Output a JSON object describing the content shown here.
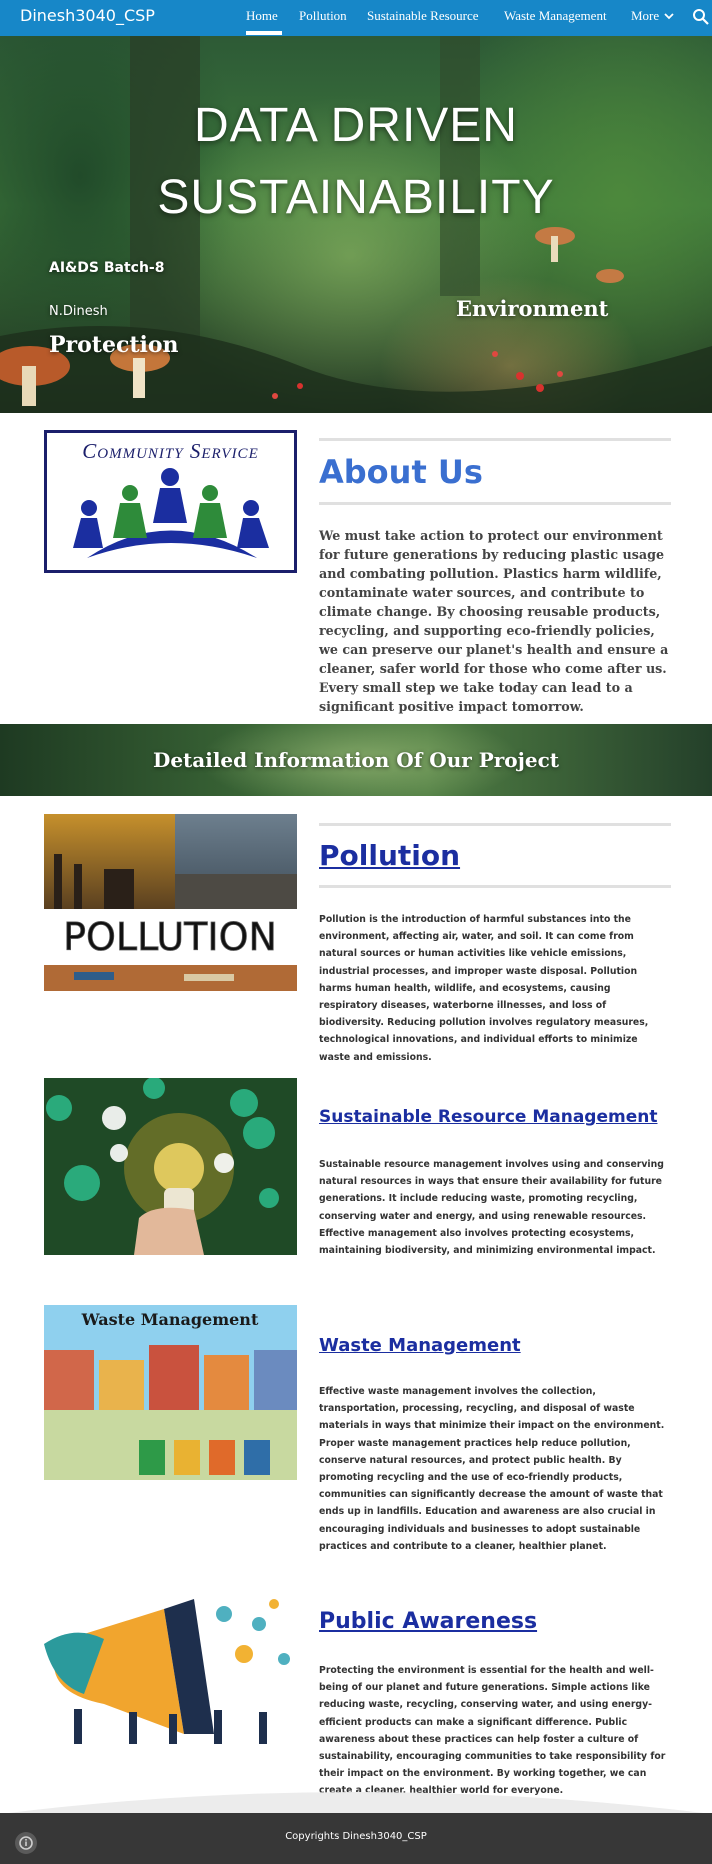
{
  "site": {
    "title": "Dinesh3040_CSP"
  },
  "nav": {
    "items": [
      {
        "label": "Home"
      },
      {
        "label": "Pollution"
      },
      {
        "label": "Sustainable Resource"
      },
      {
        "label": "Waste Management"
      },
      {
        "label": "More"
      }
    ]
  },
  "hero": {
    "title_line1": "DATA DRIVEN",
    "title_line2": "SUSTAINABILITY",
    "batch": "AI&DS Batch-8",
    "author": "N.Dinesh",
    "protection": "Protection",
    "environment": "Environment"
  },
  "about": {
    "logo_text": "Community Service",
    "heading": "About Us",
    "body": "We must take action to protect our environment for future generations by reducing plastic usage and combating pollution. Plastics harm wildlife, contaminate water sources, and contribute to climate change. By choosing reusable products, recycling, and supporting eco-friendly policies, we can preserve our planet's health and ensure a cleaner, safer world for those who come after us. Every small step we take today can lead to a significant positive impact tomorrow."
  },
  "banner": {
    "text": "Detailed Information Of Our Project"
  },
  "sections": {
    "pollution": {
      "image_text": "POLLUTION",
      "heading": "Pollution",
      "body": "Pollution is the introduction of harmful substances into the environment, affecting air, water, and soil. It can come from natural sources or human activities like vehicle emissions, industrial processes, and improper waste disposal. Pollution harms human health, wildlife, and ecosystems, causing respiratory diseases, waterborne illnesses, and loss of biodiversity. Reducing pollution involves regulatory measures, technological innovations, and individual efforts to minimize waste and emissions."
    },
    "sustainable": {
      "heading": "Sustainable Resource Management",
      "body": "Sustainable resource management involves using and conserving natural resources in ways that ensure their availability for future generations. It include reducing waste, promoting recycling, conserving water and energy, and using renewable resources. Effective management also involves protecting ecosystems, maintaining biodiversity, and minimizing environmental impact."
    },
    "waste": {
      "image_text": "Waste Management",
      "heading": "Waste Management",
      "body": "Effective waste management involves the collection, transportation, processing, recycling, and disposal of waste materials in ways that minimize their impact on the environment. Proper waste management practices help reduce pollution, conserve natural resources, and protect public health. By promoting recycling and the use of eco-friendly products, communities can significantly decrease the amount of waste that ends up in landfills. Education and awareness are also crucial in encouraging individuals and businesses to adopt sustainable practices and contribute to a cleaner, healthier planet."
    },
    "awareness": {
      "heading": "Public Awareness",
      "body": "Protecting the environment is essential for the health and well-being of our planet and future generations. Simple actions like reducing waste, recycling, conserving water, and using energy-efficient products can make a significant difference. Public awareness about these practices can help foster a culture of sustainability, encouraging communities to take responsibility for their impact on the environment. By working together, we can create a cleaner, healthier world for everyone."
    }
  },
  "footer": {
    "text": "Copyrights Dinesh3040_CSP"
  },
  "colors": {
    "nav": "#1787c8",
    "heading": "#3a6fd0",
    "link_heading": "#1b2ea0",
    "footer": "#373737"
  },
  "icons": [
    "search-icon",
    "chevron-down-icon",
    "info-icon"
  ]
}
